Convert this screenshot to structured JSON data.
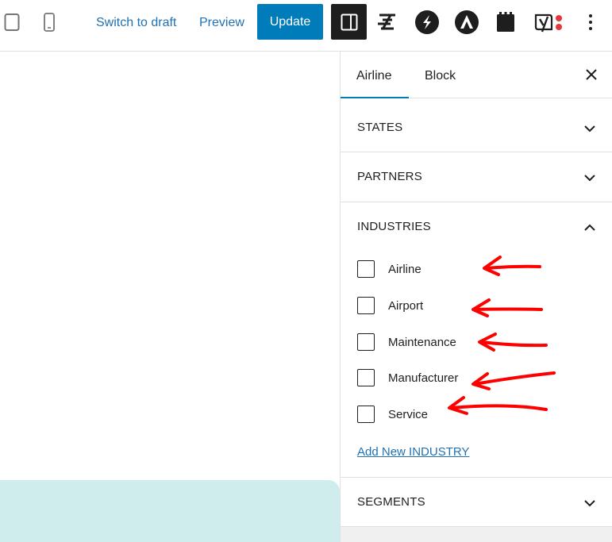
{
  "toolbar": {
    "switch_to_draft": "Switch to draft",
    "preview": "Preview",
    "update": "Update",
    "icons": [
      "tablet-icon",
      "mobile-icon",
      "settings-sidebar-icon",
      "stackable-icon",
      "strattic-icon",
      "astra-icon",
      "clipboard-icon",
      "yoast-seo-icon",
      "more-options-icon"
    ]
  },
  "sidebar": {
    "tabs": [
      {
        "label": "Airline",
        "active": true
      },
      {
        "label": "Block",
        "active": false
      }
    ],
    "panels": {
      "states": {
        "title": "STATES",
        "expanded": false
      },
      "partners": {
        "title": "PARTNERS",
        "expanded": false
      },
      "industries": {
        "title": "INDUSTRIES",
        "expanded": true,
        "terms": [
          {
            "label": "Airline",
            "checked": false
          },
          {
            "label": "Airport",
            "checked": false
          },
          {
            "label": "Maintenance",
            "checked": false
          },
          {
            "label": "Manufacturer",
            "checked": false
          },
          {
            "label": "Service",
            "checked": false
          }
        ],
        "add_new": "Add New INDUSTRY"
      },
      "segments": {
        "title": "SEGMENTS",
        "expanded": false
      }
    }
  },
  "colors": {
    "accent": "#007cba",
    "link": "#2271b1",
    "canvas_block": "#cfedec",
    "annotation": "#ff0000"
  }
}
